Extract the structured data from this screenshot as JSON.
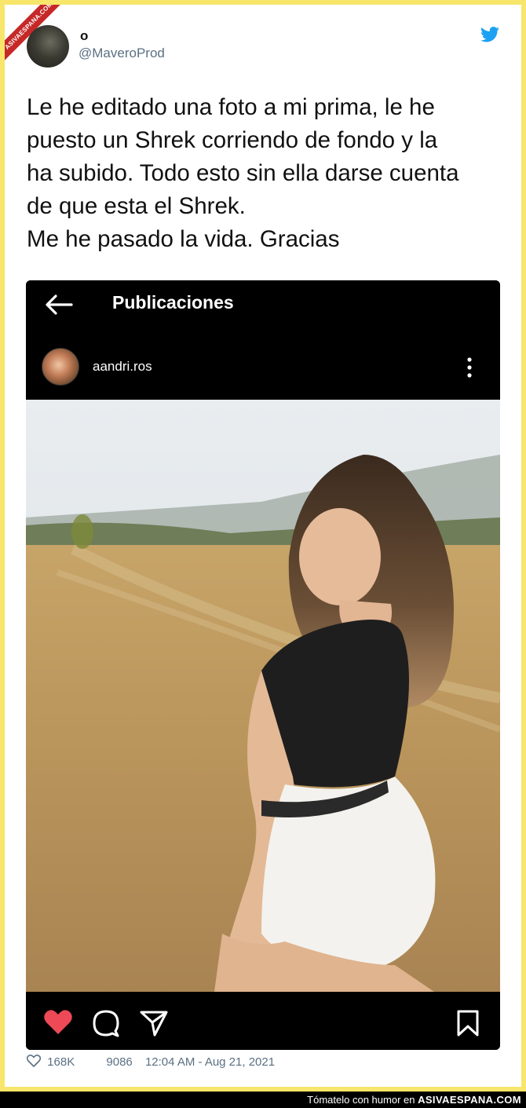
{
  "site": {
    "ribbon": "ASIVAESPANA.COM",
    "footer_prefix": "Tómatelo con humor en ",
    "footer_brand": "ASIVAESPANA.COM"
  },
  "tweet": {
    "name": "o",
    "handle": "@MaveroProd",
    "text": "Le he editado una foto a mi prima, le he\npuesto un Shrek corriendo de fondo y la\nha subido. Todo esto sin ella darse cuenta\nde que esta el Shrek.\nMe he pasado la vida. Gracias",
    "likes": "168K",
    "retweets": "9086",
    "timestamp": "12:04 AM - Aug 21, 2021"
  },
  "instagram": {
    "title": "Publicaciones",
    "username": "aandri.ros"
  },
  "colors": {
    "background": "#f7e66b",
    "twitter_blue": "#1da1f2",
    "like_red": "#ed4956",
    "secondary_text": "#5b7083"
  },
  "icons": [
    "twitter-bird-icon",
    "back-arrow-icon",
    "more-vertical-icon",
    "heart-icon",
    "comment-icon",
    "share-icon",
    "bookmark-icon",
    "like-outline-icon"
  ]
}
